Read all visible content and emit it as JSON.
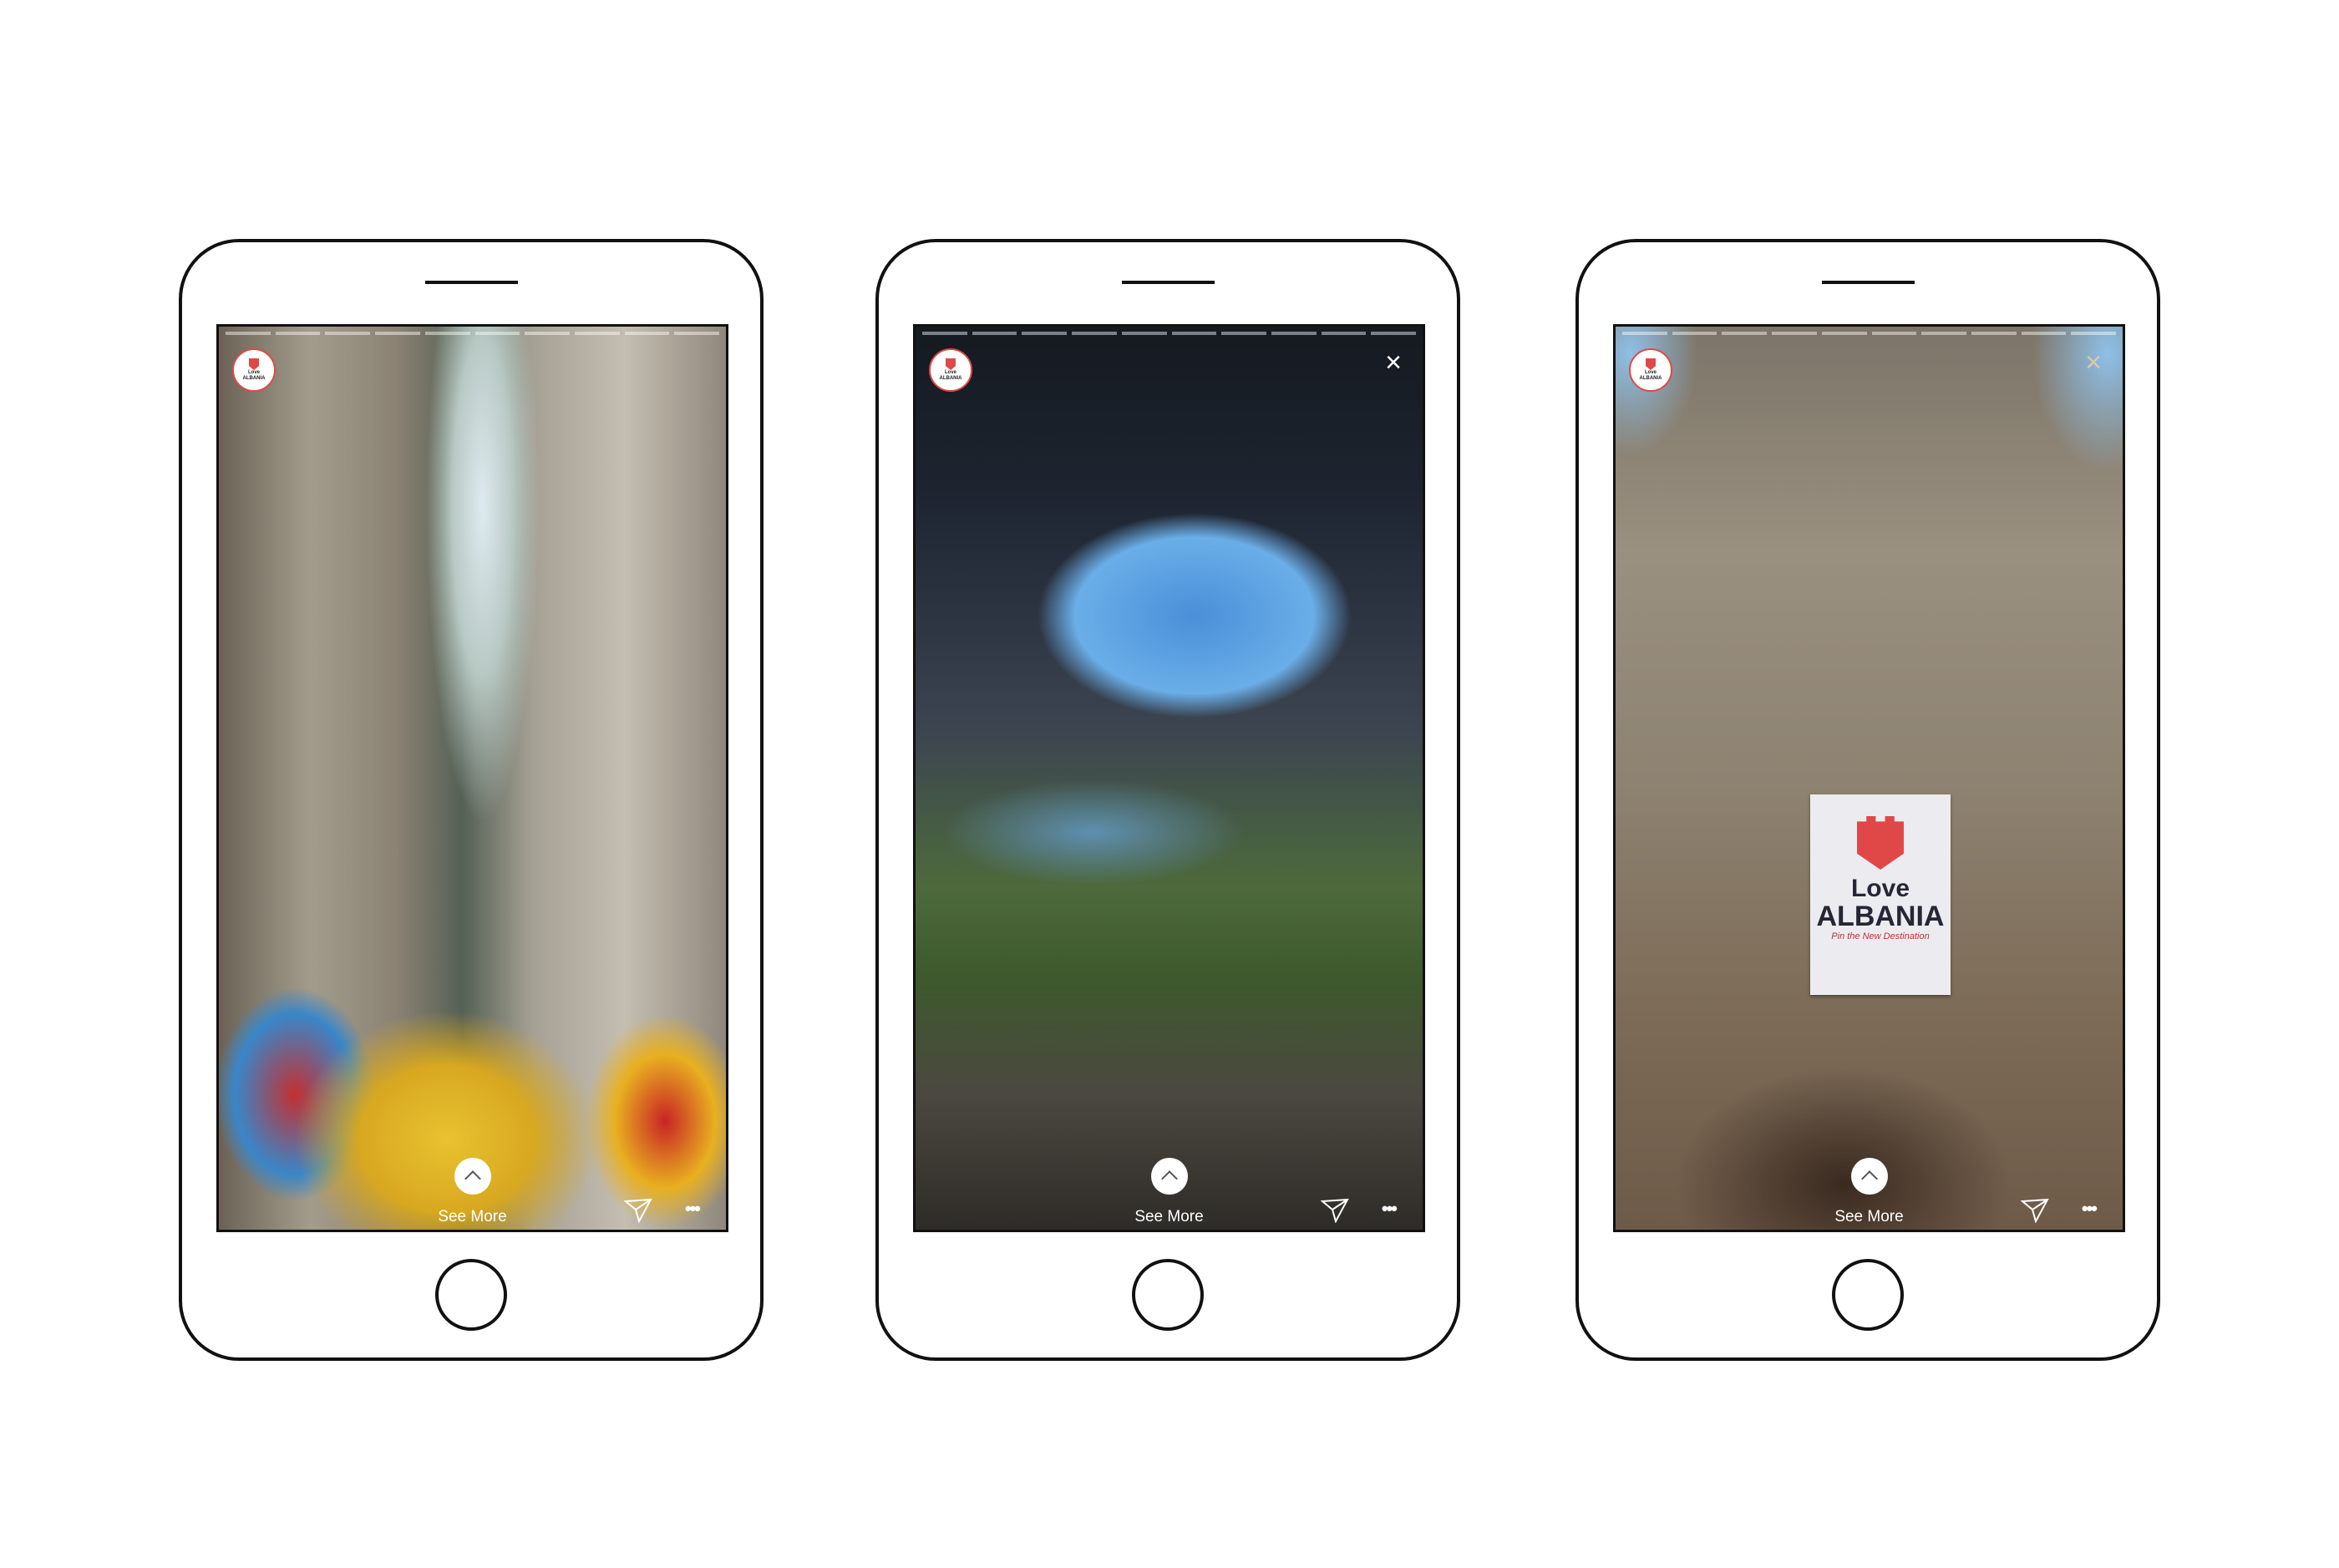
{
  "phones": [
    {
      "has_close": false,
      "see_more": "See More"
    },
    {
      "has_close": true,
      "see_more": "See More"
    },
    {
      "has_close": true,
      "see_more": "See More"
    }
  ],
  "avatar": {
    "line1": "Love",
    "line2": "ALBANIA"
  },
  "close_glyph": "×",
  "dots_glyph": "•••",
  "banner": {
    "line1": "Love",
    "line2": "ALBANIA",
    "tagline": "Pin the New Destination"
  },
  "story_segments": 10,
  "colors": {
    "brand_red": "#e04848",
    "frame": "#111111"
  }
}
